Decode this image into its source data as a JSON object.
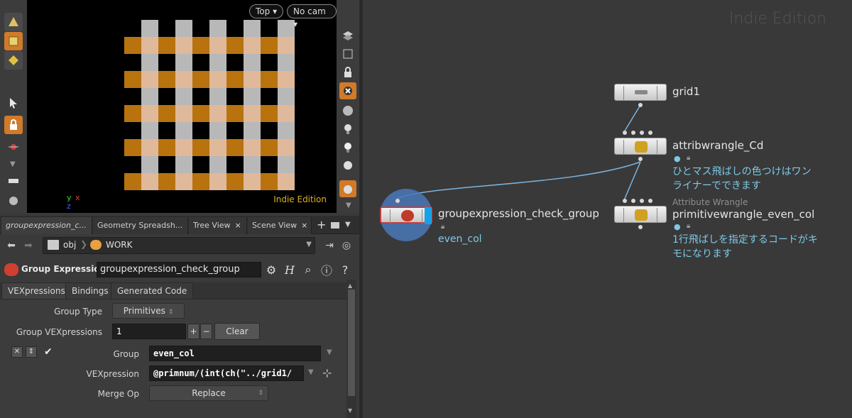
{
  "viewport": {
    "camera_view": "Top",
    "camera_name": "No cam",
    "watermark": "Indie Edition",
    "axis_y": "y",
    "axis_x": "x",
    "axis_z": "z",
    "colors": {
      "orange": "#b8730f",
      "light": "#b8b8b8",
      "peach": "#e0b89a",
      "black": "#000000"
    }
  },
  "tabs": [
    {
      "label": "groupexpression_c...",
      "close": "×"
    },
    {
      "label": "Geometry Spreadsh...",
      "close": "×"
    },
    {
      "label": "Tree View",
      "close": "×"
    },
    {
      "label": "Scene View",
      "close": "×"
    }
  ],
  "path": {
    "root": "obj",
    "current": "WORK"
  },
  "node_header": {
    "type": "Group Expression",
    "name": "groupexpression_check_group"
  },
  "param_tabs": [
    "VEXpressions",
    "Bindings",
    "Generated Code"
  ],
  "params": {
    "group_type_label": "Group Type",
    "group_type_value": "Primitives",
    "group_vex_label": "Group VEXpressions",
    "group_vex_value": "1",
    "plus": "+",
    "minus": "−",
    "clear_label": "Clear",
    "group_label": "Group",
    "group_value": "even_col",
    "vexpression_label": "VEXpression",
    "vexpression_value": "@primnum/(int(ch(\"../grid1/",
    "merge_op_label": "Merge Op",
    "merge_op_value": "Replace"
  },
  "network": {
    "watermark": "Indie Edition",
    "nodes": {
      "grid": {
        "name": "grid1"
      },
      "attribwrangle": {
        "name": "attribwrangle_Cd",
        "comment1": "ひとマス飛ばしの色つけはワン",
        "comment2": "ライナーでできます"
      },
      "groupexpr": {
        "name": "groupexpression_check_group",
        "group": "even_col"
      },
      "primwrangle": {
        "type_label": "Attribute Wrangle",
        "name": "primitivewrangle_even_col",
        "comment1": "1行飛ばしを指定するコードがキ",
        "comment2": "モになります"
      }
    }
  }
}
